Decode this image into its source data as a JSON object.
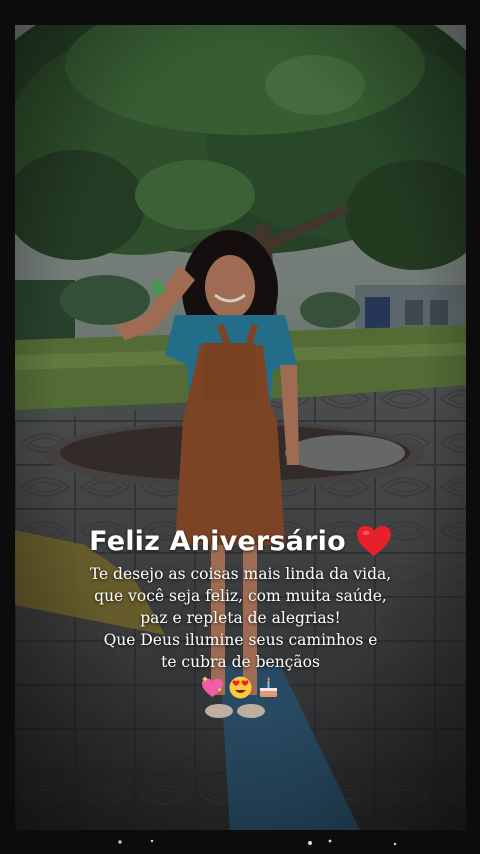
{
  "greeting": {
    "title": "Feliz Aniversário",
    "heart_icon": "red-heart-icon",
    "heart_color": "#e8202a",
    "lines": [
      "Te desejo as coisas mais linda da vida,",
      "que você seja feliz, com muita saúde,",
      "paz e repleta de alegrias!",
      "Que Deus ilumine seus caminhos e",
      "te cubra de bençãos"
    ],
    "emojis": [
      "sparkling-heart-icon",
      "heart-eyes-face-icon",
      "birthday-cake-icon"
    ]
  },
  "colors": {
    "frame": "#0c0c0d",
    "text": "#ffffff"
  }
}
